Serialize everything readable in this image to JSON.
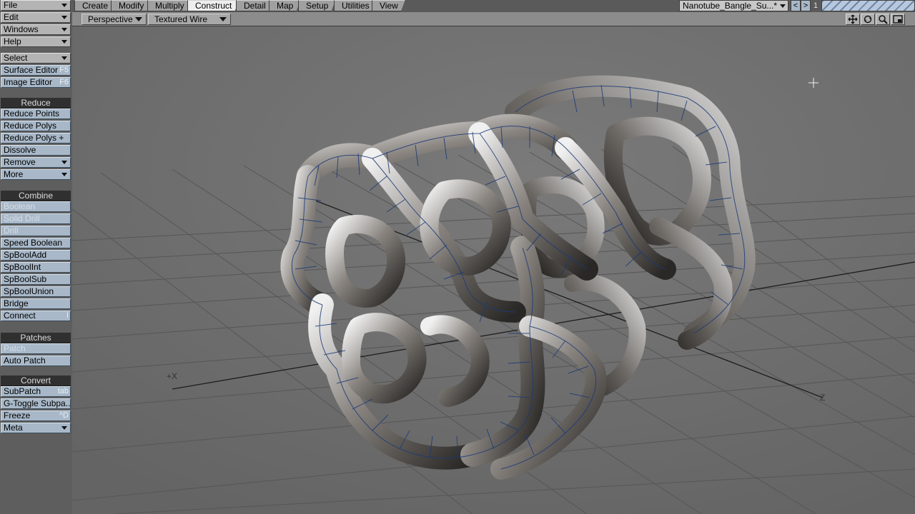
{
  "menu": {
    "file": "File",
    "edit": "Edit",
    "windows": "Windows",
    "help": "Help",
    "select": "Select",
    "surface_editor": "Surface Editor",
    "surface_editor_key": "F5",
    "image_editor": "Image Editor",
    "image_editor_key": "F6"
  },
  "reduce": {
    "header": "Reduce",
    "reduce_points": "Reduce Points",
    "reduce_polys": "Reduce Polys",
    "reduce_polys_plus": "Reduce Polys +",
    "dissolve": "Dissolve",
    "remove": "Remove",
    "more": "More"
  },
  "combine": {
    "header": "Combine",
    "boolean": "Boolean",
    "solid_drill": "Solid Drill",
    "drill": "Drill",
    "speed_boolean": "Speed Boolean",
    "spbooladd": "SpBoolAdd",
    "spboolint": "SpBoolInt",
    "spboolsub": "SpBoolSub",
    "spboolunion": "SpBoolUnion",
    "bridge": "Bridge",
    "connect": "Connect",
    "connect_key": "I"
  },
  "patches": {
    "header": "Patches",
    "patch": "Patch",
    "auto_patch": "Auto Patch"
  },
  "convert": {
    "header": "Convert",
    "subpatch": "SubPatch",
    "subpatch_key": "tab",
    "gtoggle": "G-Toggle Subpa...",
    "freeze": "Freeze",
    "freeze_key": "^D",
    "meta": "Meta"
  },
  "tabs": [
    "Create",
    "Modify",
    "Multiply",
    "Construct",
    "Detail",
    "Map",
    "Setup",
    "Utilities",
    "View"
  ],
  "active_tab": "Construct",
  "layer": {
    "object_name": "Nanotube_Bangle_Su...*",
    "prev": "<",
    "next": ">",
    "number": "1"
  },
  "viewport": {
    "view_type": "Perspective",
    "render_mode": "Textured Wire",
    "axis_x": "+X",
    "axis_z": "Z"
  },
  "colors": {
    "button_blue": "#a8b8c8",
    "header_dark": "#303030",
    "wire_blue": "#1c3a78",
    "viewport_bg": "#6e6e6e"
  }
}
